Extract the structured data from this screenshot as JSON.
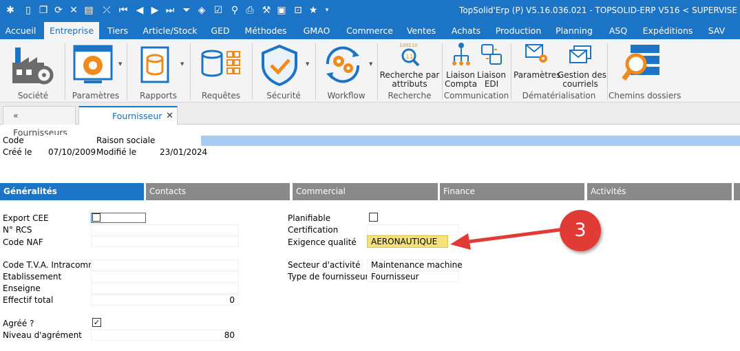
{
  "titlebar": {
    "title": "TopSolid'Erp (P)  V5.16.036.021 - TOPSOLID-ERP V516  < SUPERVISE"
  },
  "menu": {
    "items": [
      "Accueil",
      "Entreprise",
      "Tiers",
      "Article/Stock",
      "GED",
      "Méthodes",
      "GMAO",
      "Commerce",
      "Ventes",
      "Achats",
      "Production",
      "Planning",
      "ASQ",
      "Expéditions",
      "SAV"
    ],
    "active": "Entreprise"
  },
  "ribbon": {
    "societe": "Société",
    "parametres": "Paramètres",
    "rapports": "Rapports",
    "requetes": "Requêtes",
    "securite": "Sécurité",
    "workflow": "Workflow",
    "recherche_btn": [
      "Recherche par",
      "attributs"
    ],
    "recherche_group": "Recherche",
    "liaison_compta": [
      "Liaison",
      "Compta"
    ],
    "liaison_edi": [
      "Liaison",
      "EDI"
    ],
    "communication_group": "Communication",
    "parametres_dem": "Paramètres",
    "gestion_courriels": [
      "Gestion des",
      "courriels"
    ],
    "dematerialisation_group": "Dématérialisation",
    "chemins_dossiers": "Chemins dossiers"
  },
  "doctabs": {
    "back": "« Fournisseurs",
    "current": "Fournisseur",
    "close": "✕"
  },
  "header": {
    "code_label": "Code",
    "code_value": "",
    "raison_label": "Raison sociale",
    "raison_value": "",
    "cree_label": "Créé le",
    "cree_value": "07/10/2009",
    "modifie_label": "Modifié le",
    "modifie_value": "23/01/2024"
  },
  "sectabs": [
    "Généralités",
    "Contacts",
    "Commercial",
    "Finance",
    "Activités"
  ],
  "form_left": {
    "export_cee": "Export CEE",
    "n_rcs": "N° RCS",
    "code_naf": "Code NAF",
    "code_tva": "Code T.V.A. Intracomm.",
    "etablissement": "Etablissement",
    "enseigne": "Enseigne",
    "effectif_total": "Effectif total",
    "effectif_value": "0",
    "agree": "Agréé ?",
    "agree_checked": "✓",
    "niveau_agrement": "Niveau d'agrément",
    "niveau_value": "80"
  },
  "form_right": {
    "planifiable": "Planifiable",
    "certification": "Certification",
    "exigence": "Exigence qualité",
    "exigence_value": "AERONAUTIQUE",
    "secteur": "Secteur d'activité",
    "secteur_value": "Maintenance machine",
    "type_fournisseur": "Type de fournisseur",
    "type_value": "Fournisseur"
  },
  "annotation": {
    "number": "3"
  },
  "colors": {
    "brand_blue": "#1b74c5",
    "highlight_yellow": "#f3e17a",
    "annotation_red": "#e03c35"
  }
}
